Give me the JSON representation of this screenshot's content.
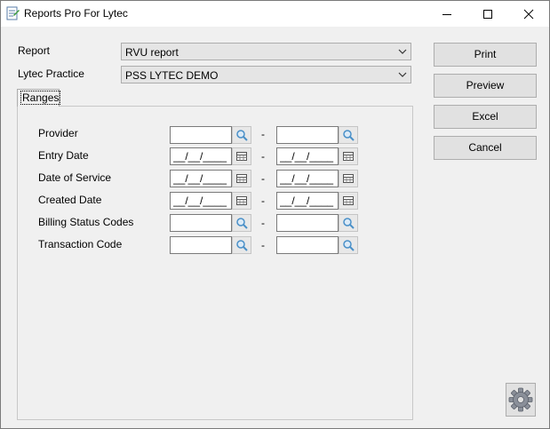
{
  "window": {
    "title": "Reports Pro For Lytec"
  },
  "report": {
    "label": "Report",
    "value": "RVU report"
  },
  "practice": {
    "label": "Lytec Practice",
    "value": "PSS LYTEC DEMO"
  },
  "tab": {
    "label": "Ranges"
  },
  "ranges": {
    "separator": "-",
    "date_mask": "__/__/____",
    "provider_label": "Provider",
    "entry_date_label": "Entry Date",
    "date_of_service_label": "Date of Service",
    "created_date_label": "Created Date",
    "billing_status_codes_label": "Billing Status Codes",
    "transaction_code_label": "Transaction Code"
  },
  "buttons": {
    "print": "Print",
    "preview": "Preview",
    "excel": "Excel",
    "cancel": "Cancel"
  },
  "colors": {
    "accent": "#0078d7",
    "lens": "#4a90c8"
  },
  "icons": {
    "lookup": "magnifier-icon",
    "calendar": "calendar-icon",
    "settings": "gear-icon"
  }
}
